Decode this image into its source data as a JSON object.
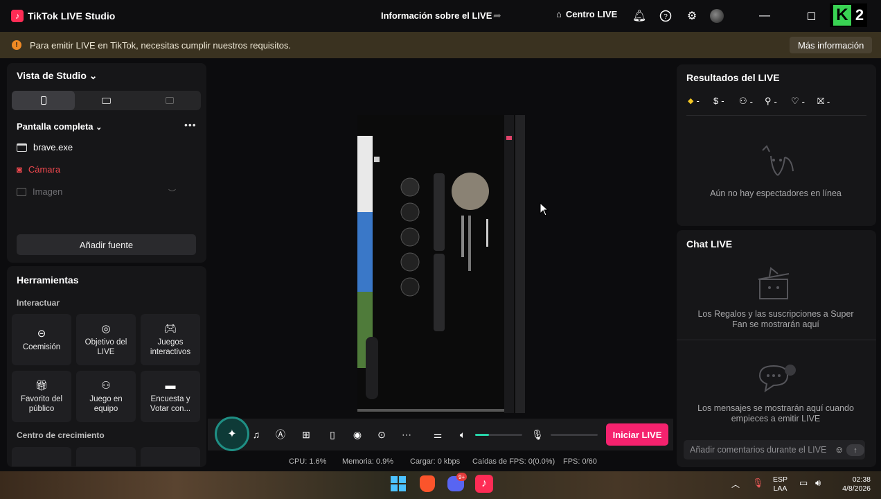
{
  "window": {
    "app_title": "TikTok LIVE Studio",
    "center_title": "Información sobre el LIVE",
    "centro_label": "Centro LIVE",
    "k2_letter": "K",
    "k2_number": "2"
  },
  "banner": {
    "text": "Para emitir LIVE en TikTok, necesitas cumplir nuestros requisitos.",
    "button": "Más información",
    "accent": "#f08a24"
  },
  "studio": {
    "view_label": "Vista de Studio",
    "scene_label": "Pantalla completa",
    "sources": [
      {
        "name": "brave.exe",
        "icon": "window-icon"
      },
      {
        "name": "Cámara",
        "icon": "camera-icon",
        "color": "#f0484e"
      },
      {
        "name": "Imagen",
        "icon": "image-icon"
      }
    ],
    "add_source": "Añadir fuente"
  },
  "tools": {
    "title": "Herramientas",
    "interact_label": "Interactuar",
    "growth_label": "Centro de crecimiento",
    "cards": [
      {
        "label": "Coemisión",
        "icon": "link-icon"
      },
      {
        "label": "Objetivo del LIVE",
        "icon": "target-icon"
      },
      {
        "label": "Juegos interactivos",
        "icon": "gamepad-icon"
      },
      {
        "label": "Favorito del público",
        "icon": "gift-icon"
      },
      {
        "label": "Juego en equipo",
        "icon": "team-icon"
      },
      {
        "label": "Encuesta y Votar con...",
        "icon": "poll-icon"
      }
    ]
  },
  "controls": {
    "go_live": "Iniciar LIVE",
    "volume_level": 0.3,
    "mic_level": 0.0,
    "accent": "#f5226e"
  },
  "stats": {
    "cpu": "CPU:  1.6%",
    "memory": "Memoria:  0.9%",
    "upload": "Cargar:  0 kbps",
    "fps_drops": "Caídas de FPS:  0(0.0%)",
    "fps": "FPS:  0/60"
  },
  "results": {
    "title": "Resultados del LIVE",
    "metrics": [
      "-",
      "-",
      "-",
      "-",
      "-",
      "-"
    ],
    "empty_text": "Aún no hay espectadores en línea"
  },
  "chat": {
    "title": "Chat LIVE",
    "gifts_text": "Los Regalos y las suscripciones a Super Fan se mostrarán aquí",
    "messages_text": "Los mensajes se mostrarán aquí cuando empieces a emitir LIVE",
    "input_placeholder": "Añadir comentarios durante el LIVE"
  },
  "taskbar": {
    "lang_top": "ESP",
    "lang_bottom": "LAA",
    "time": "02:38",
    "date": "4/8/2026",
    "discord_badge": "9+"
  }
}
